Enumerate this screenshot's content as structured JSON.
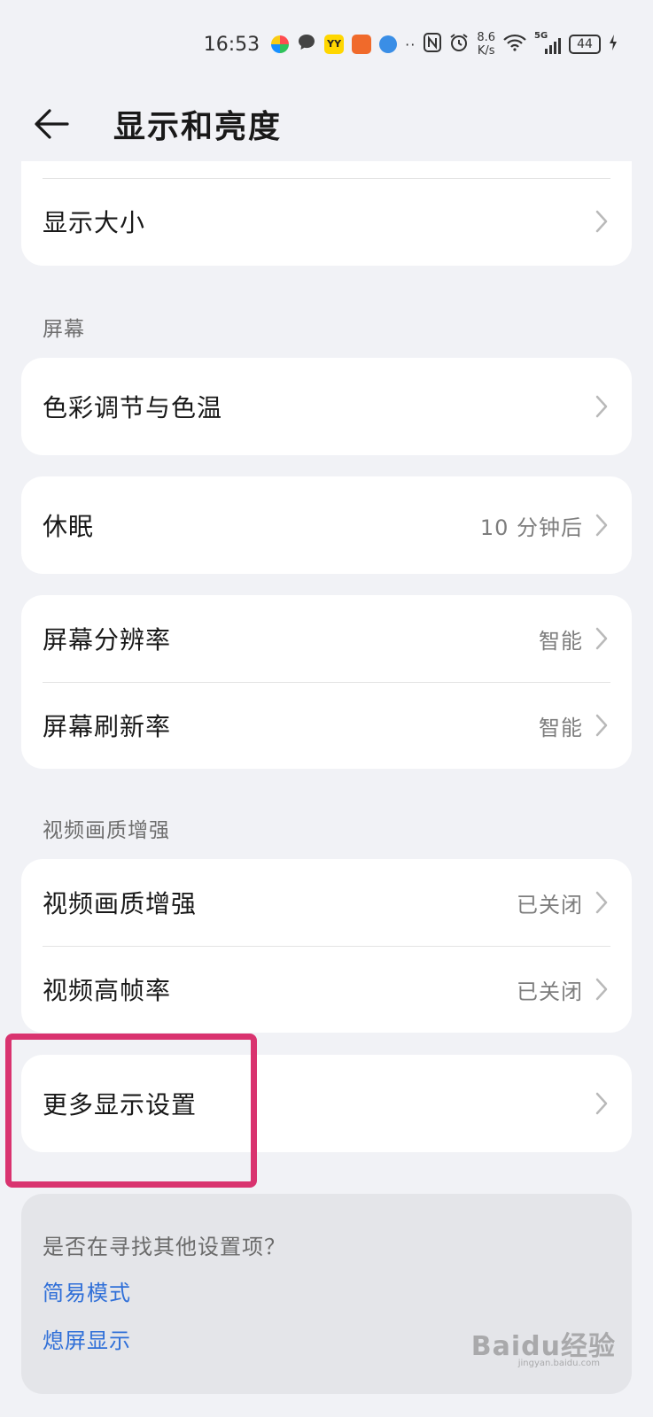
{
  "status_bar": {
    "time": "16:53",
    "net_speed_value": "8.6",
    "net_speed_unit": "K/s",
    "network_type": "5G",
    "battery": "44",
    "icons": [
      "kuaishou-icon",
      "message-icon",
      "yy-icon",
      "app-icon",
      "browser-icon",
      "nfc-icon",
      "alarm-icon",
      "wifi-icon",
      "signal-icon",
      "charging-icon"
    ]
  },
  "header": {
    "title": "显示和亮度"
  },
  "rows": {
    "display_size": {
      "label": "显示大小"
    },
    "color_temp": {
      "label": "色彩调节与色温"
    },
    "sleep": {
      "label": "休眠",
      "value": "10 分钟后"
    },
    "resolution": {
      "label": "屏幕分辨率",
      "value": "智能"
    },
    "refresh_rate": {
      "label": "屏幕刷新率",
      "value": "智能"
    },
    "video_enhance": {
      "label": "视频画质增强",
      "value": "已关闭"
    },
    "video_high_fps": {
      "label": "视频高帧率",
      "value": "已关闭"
    },
    "more_display": {
      "label": "更多显示设置"
    }
  },
  "sections": {
    "screen": "屏幕",
    "video": "视频画质增强"
  },
  "hint": {
    "title": "是否在寻找其他设置项？",
    "link1": "简易模式",
    "link2": "熄屏显示"
  },
  "watermark": {
    "text": "Baidu经验",
    "sub": "jingyan.baidu.com"
  },
  "colors": {
    "background": "#f1f2f6",
    "card": "#ffffff",
    "link": "#2f6fd8",
    "highlight": "#d9336f"
  }
}
